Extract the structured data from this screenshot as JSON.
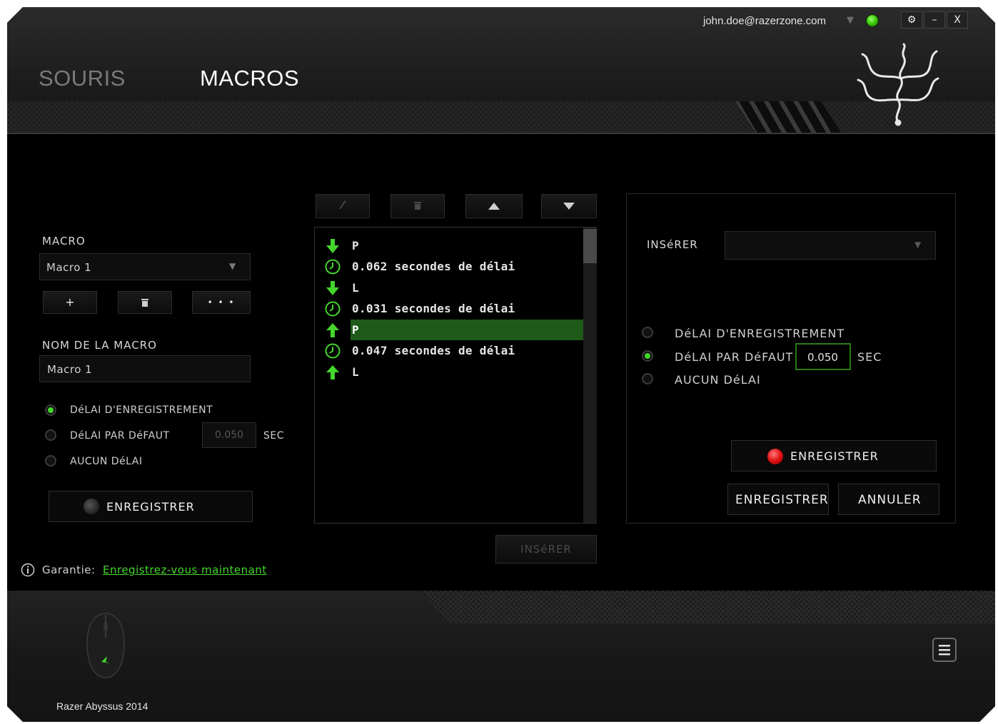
{
  "topbar": {
    "email": "john.doe@razerzone.com",
    "caret": "▼",
    "settings_label": "⚙",
    "minimize_label": "–",
    "close_label": "X"
  },
  "tabs": [
    {
      "label": "SOURIS",
      "active": false
    },
    {
      "label": "MACROS",
      "active": true
    }
  ],
  "left": {
    "macro_label": "MACRO",
    "macro_select_value": "Macro 1",
    "add_label": "+",
    "delete_label": "🗑",
    "more_label": "• • •",
    "name_label": "NOM DE LA MACRO",
    "name_value": "Macro 1",
    "radio_record_delay": "DéLAI D'ENREGISTREMENT",
    "radio_default_delay": "DéLAI PAR DéFAUT",
    "radio_no_delay": "AUCUN DéLAI",
    "default_delay_value": "0.050",
    "sec_label": "SEC",
    "record_button": "ENREGISTRER"
  },
  "list": {
    "rows": [
      {
        "type": "down",
        "text": "P",
        "selected": false
      },
      {
        "type": "delay",
        "text": "0.062 secondes de délai",
        "selected": false
      },
      {
        "type": "down",
        "text": "L",
        "selected": false
      },
      {
        "type": "delay",
        "text": "0.031 secondes de délai",
        "selected": false
      },
      {
        "type": "up",
        "text": "P",
        "selected": true
      },
      {
        "type": "delay",
        "text": "0.047 secondes de délai",
        "selected": false
      },
      {
        "type": "up",
        "text": "L",
        "selected": false
      }
    ],
    "insert_button": "INSéRER"
  },
  "right": {
    "insert_label": "INSéRER",
    "insert_select_value": "",
    "radio_record_delay": "DéLAI D'ENREGISTREMENT",
    "radio_default_delay": "DéLAI PAR DéFAUT",
    "radio_no_delay": "AUCUN DéLAI",
    "default_delay_value": "0.050",
    "sec_label": "SEC",
    "record_button": "ENREGISTRER",
    "save_button": "ENREGISTRER",
    "cancel_button": "ANNULER"
  },
  "warranty": {
    "label": "Garantie:",
    "link": "Enregistrez-vous maintenant"
  },
  "device": {
    "name": "Razer Abyssus 2014"
  },
  "colors": {
    "accent": "#44d62c",
    "selection": "#1f5a1a",
    "record_red": "#e01010"
  }
}
